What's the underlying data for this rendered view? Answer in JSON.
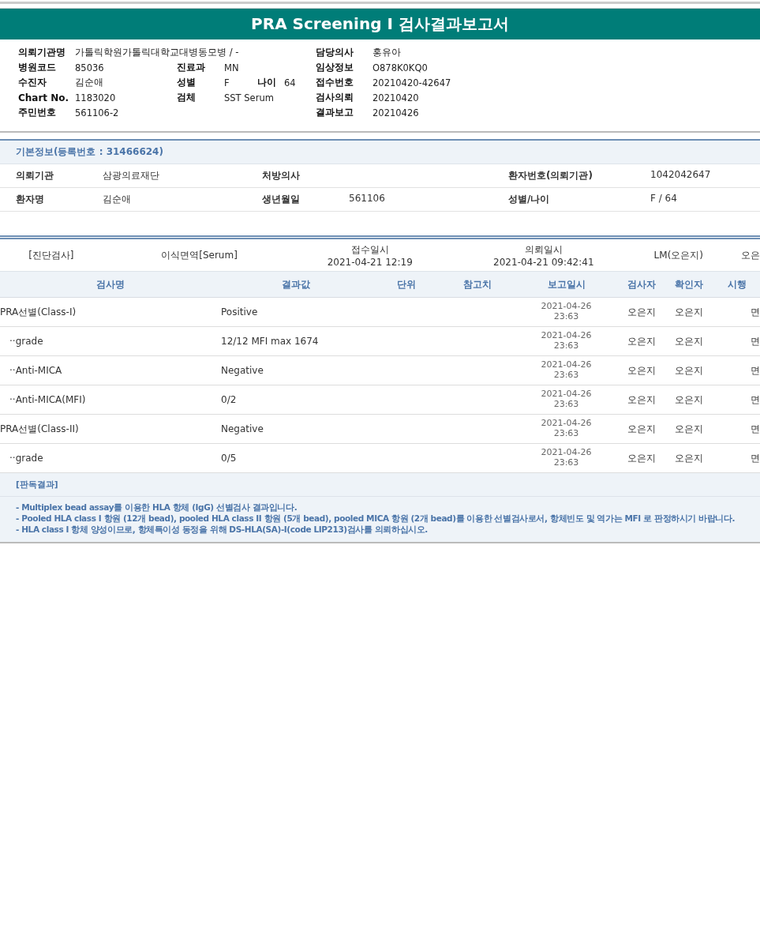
{
  "report_title": "PRA Screening I 검사결과보고서",
  "request_info": {
    "rows": [
      {
        "left": [
          {
            "label": "의뢰기관명",
            "value": "가톨릭학원가톨릭대학교대병동모병 / -"
          }
        ],
        "right": [
          {
            "label": "담당의사",
            "value": "홍유아"
          }
        ]
      },
      {
        "left": [
          {
            "label": "병원코드",
            "value": "85036"
          }
        ],
        "middle": [
          {
            "label": "진료과",
            "value": "MN"
          }
        ],
        "right": [
          {
            "label": "임상정보",
            "value": "O878K0KQ0"
          }
        ]
      },
      {
        "left": [
          {
            "label": "수진자",
            "value": "김순애"
          }
        ],
        "middle": [
          {
            "label": "성별",
            "value": "F"
          },
          {
            "label": "나이",
            "value": "64"
          }
        ],
        "right": [
          {
            "label": "접수번호",
            "value": "20210420-42647"
          }
        ]
      },
      {
        "left": [
          {
            "label": "Chart No.",
            "value": "1183020"
          }
        ],
        "middle": [
          {
            "label": "검체",
            "value": "SST Serum"
          }
        ],
        "right": [
          {
            "label": "검사의뢰",
            "value": "20210420"
          }
        ]
      },
      {
        "left": [
          {
            "label": "주민번호",
            "value": "561106-2"
          }
        ],
        "right": [
          {
            "label": "결과보고",
            "value": "20210426"
          }
        ]
      }
    ]
  },
  "basic_info": {
    "title": "기본정보(등록번호 : 31466624)",
    "rows": [
      [
        {
          "label": "의뢰기관",
          "value": "삼광의료재단"
        },
        {
          "label": "처방의사"
        },
        {
          "label": "환자번호(의뢰기관)",
          "value": "1042042647"
        }
      ],
      [
        {
          "label": "환자명",
          "value": "김순애"
        },
        {
          "label": "생년월일",
          "value": "561106"
        },
        {
          "label": "성별/나이",
          "value": "F / 64"
        }
      ]
    ]
  },
  "order": [
    {
      "text": "[진단검사]"
    },
    {
      "text": "이식면역[Serum]"
    },
    {
      "label": "접수일시",
      "text": "2021-04-21 12:19"
    },
    {
      "label": "의뢰일시",
      "text": "2021-04-21 09:42:41"
    },
    {
      "text": "LM(오은지)"
    },
    {
      "text": "오은"
    }
  ],
  "results": {
    "columns": [
      "검사명",
      "결과값",
      "단위",
      "참고치",
      "보고일시",
      "검사자",
      "확인자",
      "시행"
    ],
    "rows": [
      {
        "name": "PRA선별(Class-I)",
        "result": "Positive",
        "date": "2021-04-26",
        "time": "23:63",
        "tester": "오은지",
        "confirmer": "오은지",
        "site": "면",
        "children": [
          {
            "name": "··grade",
            "result": "12/12 MFI max 1674",
            "date": "2021-04-26",
            "time": "23:63",
            "tester": "오은지",
            "confirmer": "오은지",
            "site": "면"
          },
          {
            "name": "··Anti-MICA",
            "result": "Negative",
            "date": "2021-04-26",
            "time": "23:63",
            "tester": "오은지",
            "confirmer": "오은지",
            "site": "면"
          },
          {
            "name": "··Anti-MICA(MFI)",
            "result": "0/2",
            "date": "2021-04-26",
            "time": "23:63",
            "tester": "오은지",
            "confirmer": "오은지",
            "site": "면"
          }
        ]
      },
      {
        "name": "PRA선별(Class-II)",
        "result": "Negative",
        "date": "2021-04-26",
        "time": "23:63",
        "tester": "오은지",
        "confirmer": "오은지",
        "site": "면",
        "children": [
          {
            "name": "··grade",
            "result": "0/5",
            "date": "2021-04-26",
            "time": "23:63",
            "tester": "오은지",
            "confirmer": "오은지",
            "site": "면"
          }
        ]
      }
    ]
  },
  "interpretation": {
    "title": "[판독결과]",
    "lines": [
      "- Multiplex bead assay를 이용한 HLA 항체 (IgG) 선별검사 결과입니다.",
      "- Pooled HLA class I 항원 (12개 bead), pooled HLA class II 항원 (5개 bead), pooled MICA 항원 (2개 bead)를 이용한 선별검사로서, 항체빈도 및 역가는 MFI 로 판정하시기 바랍니다.",
      "- HLA class I 항체 양성이므로, 항체특이성 동정을 위해 DS-HLA(SA)-I(code LIP213)검사를 의뢰하십시오."
    ]
  }
}
